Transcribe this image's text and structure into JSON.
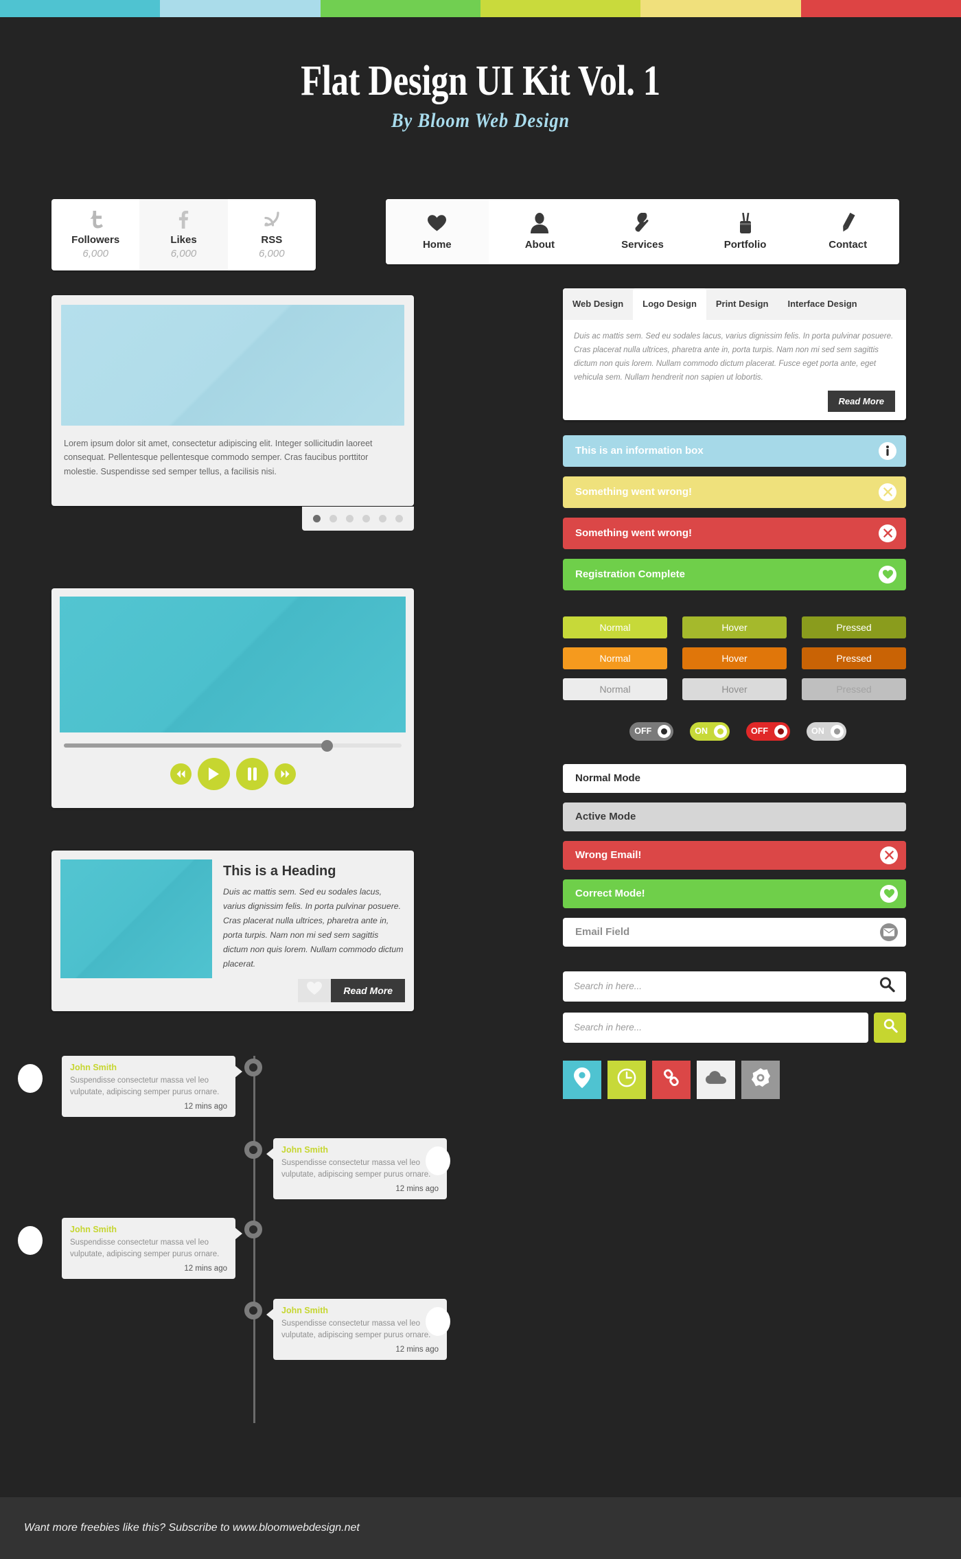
{
  "topbar_colors": [
    "#4fc3d1",
    "#aadcea",
    "#71cf51",
    "#c9da3c",
    "#f0e07c",
    "#dd4444"
  ],
  "header": {
    "title": "Flat Design UI Kit Vol. 1",
    "subtitle": "By Bloom Web Design"
  },
  "stats": {
    "items": [
      {
        "icon": "twitter-icon",
        "label": "Followers",
        "value": "6,000"
      },
      {
        "icon": "facebook-icon",
        "label": "Likes",
        "value": "6,000"
      },
      {
        "icon": "rss-icon",
        "label": "RSS",
        "value": "6,000"
      }
    ]
  },
  "nav": {
    "items": [
      {
        "icon": "heart-icon",
        "label": "Home"
      },
      {
        "icon": "user-icon",
        "label": "About"
      },
      {
        "icon": "wrench-icon",
        "label": "Services"
      },
      {
        "icon": "pencil-cup-icon",
        "label": "Portfolio"
      },
      {
        "icon": "pencil-icon",
        "label": "Contact"
      }
    ]
  },
  "carousel": {
    "text": "Lorem ipsum dolor sit amet, consectetur adipiscing elit. Integer sollicitudin laoreet consequat. Pellentesque pellentesque commodo semper. Cras faucibus porttitor molestie. Suspendisse sed semper tellus, a facilisis nisi.",
    "dot_count": 6,
    "active_dot": 0
  },
  "video": {
    "progress_percent": 78,
    "controls": [
      "rewind-icon",
      "play-icon",
      "pause-icon",
      "fast-forward-icon"
    ]
  },
  "media": {
    "heading": "This is a Heading",
    "paragraph": "Duis ac mattis sem. Sed eu sodales lacus, varius dignissim felis. In porta pulvinar posuere. Cras placerat nulla ultrices, pharetra ante in, porta turpis. Nam non mi sed sem sagittis dictum non quis lorem. Nullam commodo dictum placerat.",
    "read_more": "Read More",
    "like_icon": "heart-icon"
  },
  "timeline": {
    "items": [
      {
        "name": "John Smith",
        "text": "Suspendisse consectetur massa vel leo vulputate, adipiscing semper purus ornare.",
        "time": "12 mins ago",
        "side": "left"
      },
      {
        "name": "John Smith",
        "text": "Suspendisse consectetur massa vel leo vulputate, adipiscing semper purus ornare.",
        "time": "12 mins ago",
        "side": "right"
      },
      {
        "name": "John Smith",
        "text": "Suspendisse consectetur massa vel leo vulputate, adipiscing semper purus ornare.",
        "time": "12 mins ago",
        "side": "left"
      },
      {
        "name": "John Smith",
        "text": "Suspendisse consectetur massa vel leo vulputate, adipiscing semper purus ornare.",
        "time": "12 mins ago",
        "side": "right"
      }
    ]
  },
  "tabs": {
    "items": [
      {
        "label": "Web Design",
        "active": false
      },
      {
        "label": "Logo  Design",
        "active": true
      },
      {
        "label": "Print Design",
        "active": false
      },
      {
        "label": "Interface Design",
        "active": false
      }
    ],
    "body": "Duis ac mattis sem. Sed eu sodales lacus, varius dignissim felis. In porta pulvinar posuere. Cras placerat nulla ultrices, pharetra ante in, porta turpis. Nam non mi sed sem sagittis dictum non quis lorem. Nullam commodo dictum placerat. Fusce eget porta ante, eget vehicula sem. Nullam hendrerit non sapien ut lobortis.",
    "read_more": "Read More"
  },
  "alerts": [
    {
      "text": "This is an information box",
      "bg": "#a6d9e8",
      "icon": "info-icon",
      "icon_color": "#2e2e2e"
    },
    {
      "text": "Something went wrong!",
      "bg": "#efe17c",
      "icon": "x-icon",
      "icon_color": "#efe17c"
    },
    {
      "text": "Something went wrong!",
      "bg": "#db4747",
      "icon": "x-icon",
      "icon_color": "#db4747"
    },
    {
      "text": "Registration Complete",
      "bg": "#6fcf4a",
      "icon": "heart-icon",
      "icon_color": "#6fcf4a"
    }
  ],
  "buttons": [
    {
      "label": "Normal",
      "bg": "#c7d939",
      "fg": "#ffffff"
    },
    {
      "label": "Hover",
      "bg": "#a5b92c",
      "fg": "#ffffff"
    },
    {
      "label": "Pressed",
      "bg": "#8a9c1d",
      "fg": "#ffffff"
    },
    {
      "label": "Normal",
      "bg": "#f59a1e",
      "fg": "#ffffff"
    },
    {
      "label": "Hover",
      "bg": "#e0760a",
      "fg": "#ffffff"
    },
    {
      "label": "Pressed",
      "bg": "#c96305",
      "fg": "#ffffff"
    },
    {
      "label": "Normal",
      "bg": "#ececec",
      "fg": "#8e8e8e"
    },
    {
      "label": "Hover",
      "bg": "#dadada",
      "fg": "#8e8e8e"
    },
    {
      "label": "Pressed",
      "bg": "#bfbfbf",
      "fg": "#a3a3a3"
    }
  ],
  "toggles": [
    {
      "label": "OFF",
      "bg": "#7a7a7a",
      "knob_dot": "#2b2b2b",
      "state": "off"
    },
    {
      "label": "ON",
      "bg": "#c7d939",
      "knob_dot": "#c7d939",
      "state": "on"
    },
    {
      "label": "OFF",
      "bg": "#e02828",
      "knob_dot": "#8c0f0f",
      "state": "off"
    },
    {
      "label": "ON",
      "bg": "#d4d4d4",
      "knob_dot": "#9a9a9a",
      "state": "on"
    }
  ],
  "fields": [
    {
      "label": "Normal Mode",
      "bg": "#ffffff",
      "fg": "#2e2e2e",
      "icon": null
    },
    {
      "label": "Active Mode",
      "bg": "#d6d6d6",
      "fg": "#3a3a3a",
      "icon": null
    },
    {
      "label": "Wrong Email!",
      "bg": "#db4747",
      "fg": "#ffffff",
      "icon": "x-icon",
      "icon_bg": "#ffffff",
      "icon_fg": "#db4747"
    },
    {
      "label": "Correct Mode!",
      "bg": "#6fcf4a",
      "fg": "#ffffff",
      "icon": "heart-icon",
      "icon_bg": "#ffffff",
      "icon_fg": "#6fcf4a"
    },
    {
      "label": "Email Field",
      "bg": "#ffffff",
      "fg": "#8e8e8e",
      "icon": "envelope-icon",
      "icon_bg": "#8e8e8e",
      "icon_fg": "#ffffff"
    }
  ],
  "search": {
    "placeholder_1": "Search in here...",
    "placeholder_2": "Search in here...",
    "button_icon": "search-icon",
    "button_bg": "#c7d939"
  },
  "tiles": [
    {
      "icon": "map-pin-icon",
      "bg": "#4fc3d1",
      "fg": "#ffffff"
    },
    {
      "icon": "clock-icon",
      "bg": "#c7d939",
      "fg": "#ffffff"
    },
    {
      "icon": "link-icon",
      "bg": "#db4747",
      "fg": "#ffffff"
    },
    {
      "icon": "cloud-icon",
      "bg": "#f0f0f0",
      "fg": "#707070"
    },
    {
      "icon": "gear-icon",
      "bg": "#989898",
      "fg": "#ffffff"
    }
  ],
  "footer": {
    "text": "Want more freebies like this? Subscribe to www.bloomwebdesign.net"
  }
}
